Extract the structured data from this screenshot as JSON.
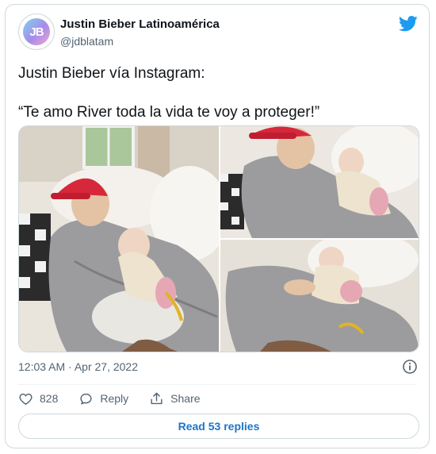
{
  "author": {
    "display_name": "Justin Bieber Latinoamérica",
    "handle": "@jdblatam",
    "avatar_initials": "JB",
    "avatar_icon": "jb-logo-avatar"
  },
  "brand": {
    "icon": "twitter-bird-icon",
    "color": "#1d9bf0"
  },
  "tweet": {
    "line1": "Justin Bieber vía Instagram:",
    "line2": "“Te amo River toda la vida te voy a proteger!”"
  },
  "media": {
    "photos": [
      {
        "id": "photo-main"
      },
      {
        "id": "photo-top-right"
      },
      {
        "id": "photo-bottom-right"
      }
    ]
  },
  "meta": {
    "timestamp": "12:03 AM · Apr 27, 2022",
    "info_icon": "info-icon"
  },
  "actions": {
    "likes_count": "828",
    "reply_label": "Reply",
    "share_label": "Share"
  },
  "read_replies_label": "Read 53 replies",
  "colors": {
    "text_primary": "#0f1419",
    "text_secondary": "#536471",
    "link_blue": "#1d75c9",
    "border": "#cfd9de"
  }
}
